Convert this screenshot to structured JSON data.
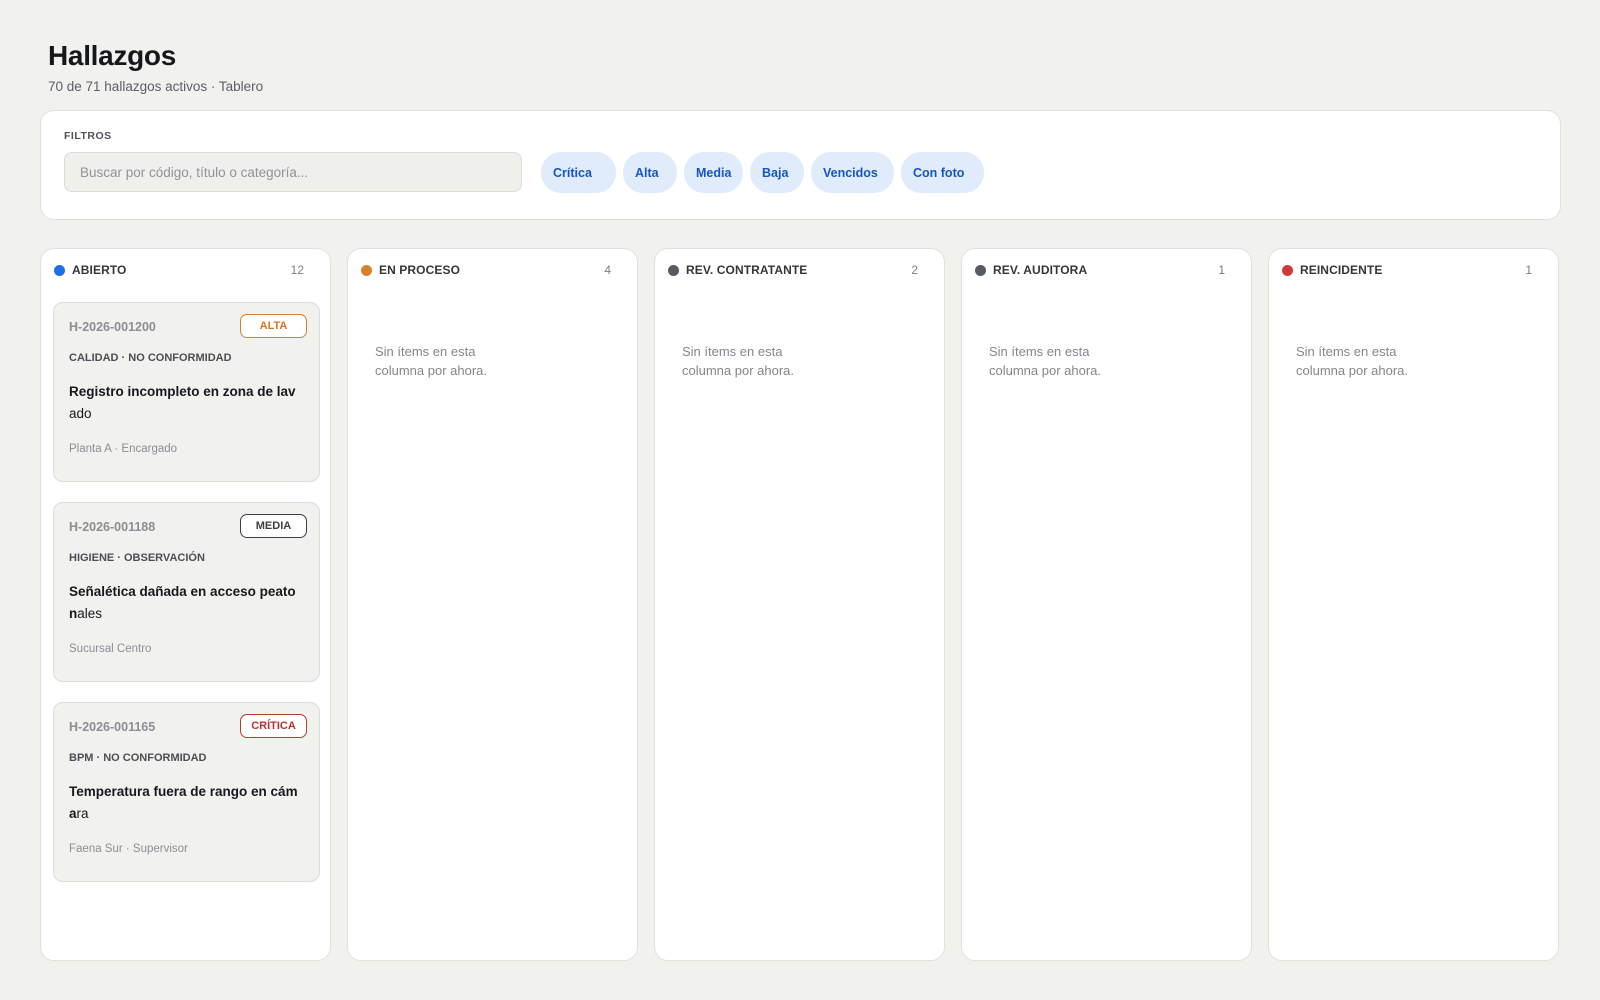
{
  "header": {
    "title": "Hallazgos",
    "subtitle": "70 de 71 hallazgos activos · Tablero"
  },
  "filters": {
    "label": "FILTROS",
    "search_placeholder": "Buscar por código, título o categoría...",
    "search_value": "",
    "chips": [
      "Crítica",
      "Alta",
      "Media",
      "Baja",
      "Vencidos",
      "Con foto"
    ],
    "chip_bg": "#e0ebfb",
    "chip_color": "#1656c4"
  },
  "columns": [
    {
      "title": "ABIERTO",
      "count": "12",
      "dot_color": "#1f6fe5",
      "empty_text": ""
    },
    {
      "title": "EN PROCESO",
      "count": "4",
      "dot_color": "#d9822b",
      "empty_text": "Sin ítems en esta columna por ahora."
    },
    {
      "title": "REV. CONTRATANTE",
      "count": "2",
      "dot_color": "#555a63",
      "empty_text": "Sin ítems en esta columna por ahora."
    },
    {
      "title": "REV. AUDITORA",
      "count": "1",
      "dot_color": "#555a63",
      "empty_text": "Sin ítems en esta columna por ahora."
    },
    {
      "title": "REINCIDENTE",
      "count": "1",
      "dot_color": "#d23a3a",
      "empty_text": "Sin ítems en esta columna por ahora."
    }
  ],
  "cards": [
    {
      "code": "H-2026-001200",
      "severity": "ALTA",
      "category": "CALIDAD · NO CONFORMIDAD",
      "title_bold": "Registro incompleto en zona de lav",
      "title_rest": "ado",
      "meta": "Planta A · Encargado"
    },
    {
      "code": "H-2026-001188",
      "severity": "MEDIA",
      "category": "HIGIENE · OBSERVACIÓN",
      "title_bold": "Señalética dañada en acceso peaton",
      "title_rest": "ales",
      "meta": "Sucursal Centro"
    },
    {
      "code": "H-2026-001165",
      "severity": "CRÍTICA",
      "category": "BPM · NO CONFORMIDAD",
      "title_bold": "Temperatura fuera de rango en cáma",
      "title_rest": "ra",
      "meta": "Faena Sur · Supervisor"
    }
  ],
  "severity_colors": {
    "alta": "#d2761e",
    "media": "#3c4048",
    "critica": "#b8322a"
  }
}
